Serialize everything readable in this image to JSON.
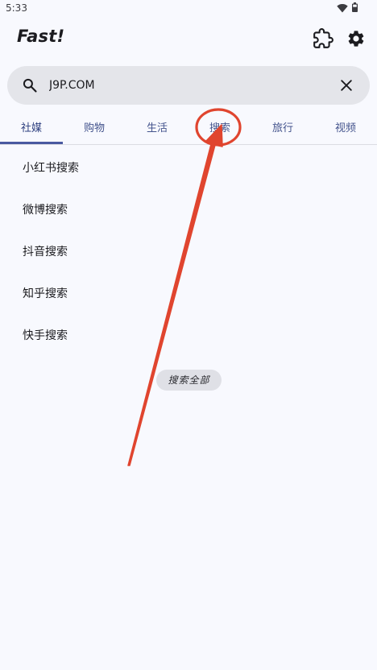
{
  "status_bar": {
    "time": "5:33"
  },
  "app": {
    "title": "Fast!"
  },
  "search": {
    "value": "J9P.COM"
  },
  "tabs": [
    {
      "label": "社媒",
      "active": true
    },
    {
      "label": "购物",
      "active": false
    },
    {
      "label": "生活",
      "active": false
    },
    {
      "label": "搜索",
      "active": false
    },
    {
      "label": "旅行",
      "active": false
    },
    {
      "label": "视频",
      "active": false
    }
  ],
  "results": [
    {
      "label": "小红书搜索"
    },
    {
      "label": "微博搜索"
    },
    {
      "label": "抖音搜索"
    },
    {
      "label": "知乎搜索"
    },
    {
      "label": "快手搜索"
    }
  ],
  "search_all_label": "搜索全部",
  "colors": {
    "accent": "#4a5aa0",
    "annotation": "#e0452f",
    "background": "#f8f9fe"
  },
  "icons": [
    "wifi-icon",
    "battery-icon",
    "puzzle-icon",
    "gear-icon",
    "search-icon",
    "close-icon"
  ]
}
